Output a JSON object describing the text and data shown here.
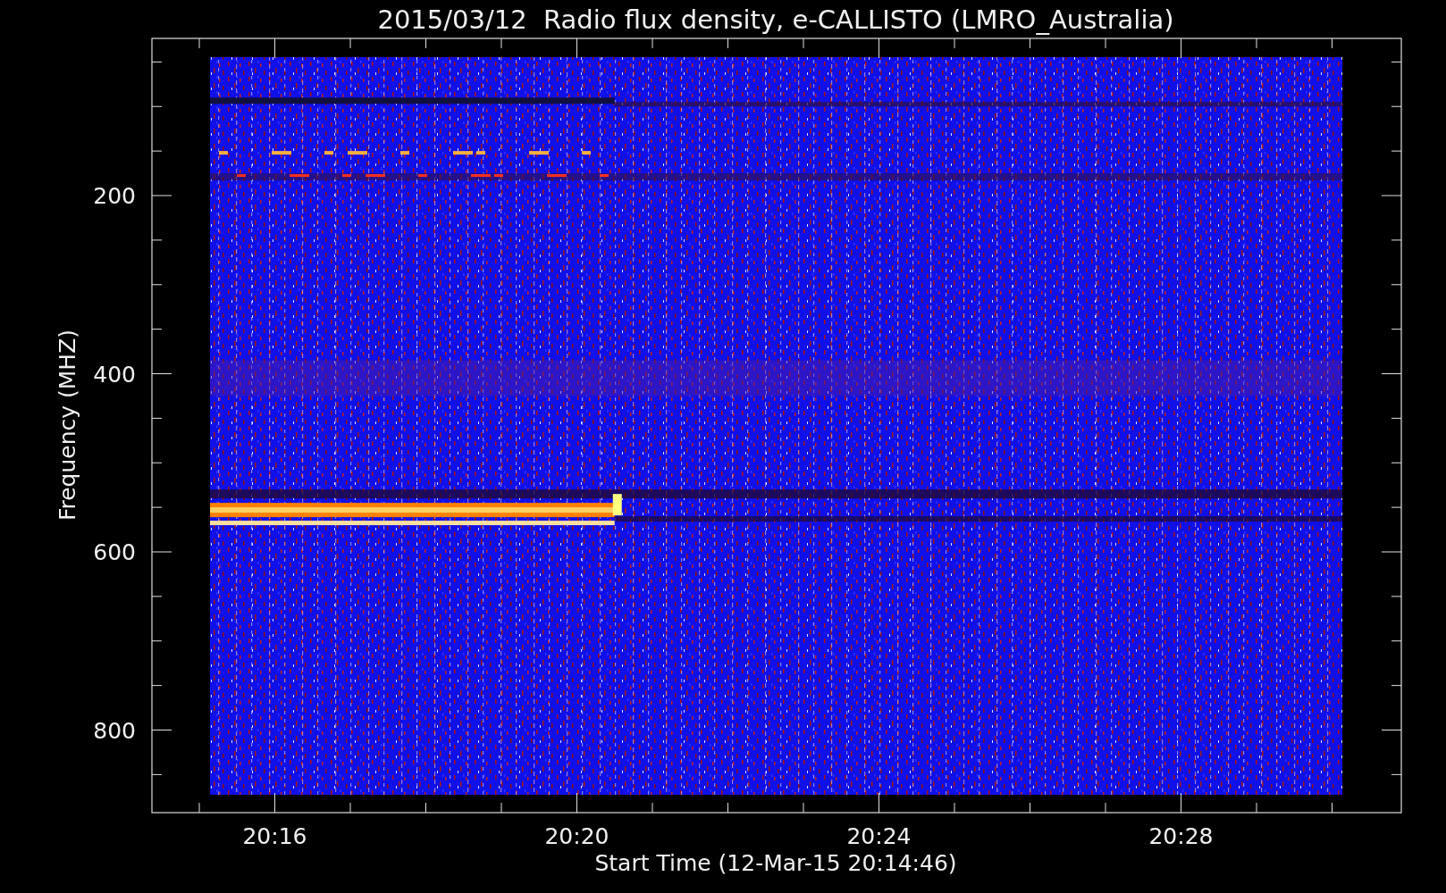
{
  "title": "2015/03/12  Radio flux density, e-CALLISTO (LMRO_Australia)",
  "y_axis": {
    "label": "Frequency (MHZ)",
    "ticks": [
      "200",
      "400",
      "600",
      "800"
    ]
  },
  "x_axis": {
    "label": "Start Time (12-Mar-15 20:14:46)",
    "ticks": [
      "20:16",
      "20:20",
      "20:24",
      "20:28"
    ]
  }
}
